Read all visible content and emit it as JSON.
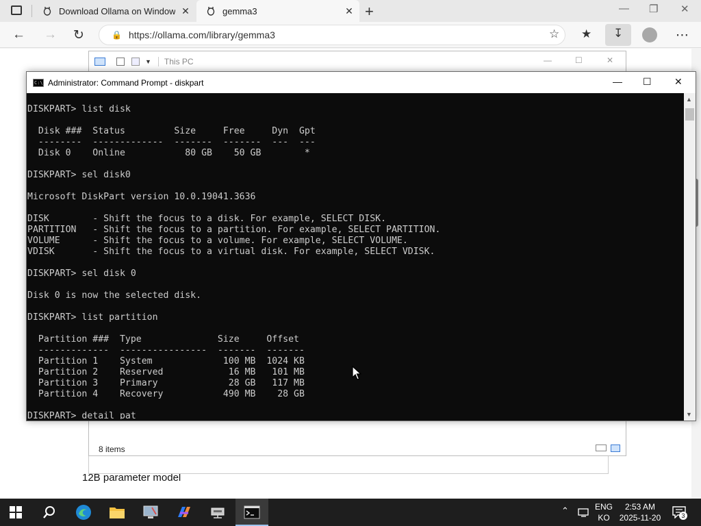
{
  "browser": {
    "tabs": [
      {
        "title": "Download Ollama on Windows",
        "close": "✕"
      },
      {
        "title": "gemma3",
        "close": "✕"
      }
    ],
    "new_tab": "+",
    "url": "https://ollama.com/library/gemma3",
    "window_controls": {
      "minimize": "—",
      "restore": "❐",
      "close": "✕"
    }
  },
  "page": {
    "model_description": "12B parameter model"
  },
  "explorer": {
    "title": "This PC",
    "status": "8 items",
    "window_controls": {
      "minimize": "—",
      "restore": "☐",
      "close": "✕"
    }
  },
  "cmd": {
    "title": "Administrator: Command Prompt - diskpart",
    "window_controls": {
      "minimize": "—",
      "maximize": "☐",
      "close": "✕"
    },
    "lines": [
      "DISKPART> list disk",
      "",
      "  Disk ###  Status         Size     Free     Dyn  Gpt",
      "  --------  -------------  -------  -------  ---  ---",
      "  Disk 0    Online           80 GB    50 GB        *",
      "",
      "DISKPART> sel disk0",
      "",
      "Microsoft DiskPart version 10.0.19041.3636",
      "",
      "DISK        - Shift the focus to a disk. For example, SELECT DISK.",
      "PARTITION   - Shift the focus to a partition. For example, SELECT PARTITION.",
      "VOLUME      - Shift the focus to a volume. For example, SELECT VOLUME.",
      "VDISK       - Shift the focus to a virtual disk. For example, SELECT VDISK.",
      "",
      "DISKPART> sel disk 0",
      "",
      "Disk 0 is now the selected disk.",
      "",
      "DISKPART> list partition",
      "",
      "  Partition ###  Type              Size     Offset",
      "  -------------  ----------------  -------  -------",
      "  Partition 1    System             100 MB  1024 KB",
      "  Partition 2    Reserved            16 MB   101 MB",
      "  Partition 3    Primary             28 GB   117 MB",
      "  Partition 4    Recovery           490 MB    28 GB",
      "",
      "DISKPART> detail pat"
    ]
  },
  "taskbar": {
    "icons": [
      "windows-start-icon",
      "search-icon",
      "edge-icon",
      "file-explorer-icon",
      "computer-management-icon",
      "copilot-icon",
      "network-drive-icon",
      "command-prompt-icon"
    ],
    "lang_top": "ENG",
    "lang_bottom": "KO",
    "time": "2:53 AM",
    "date": "2025-11-20",
    "notification_count": "3"
  }
}
